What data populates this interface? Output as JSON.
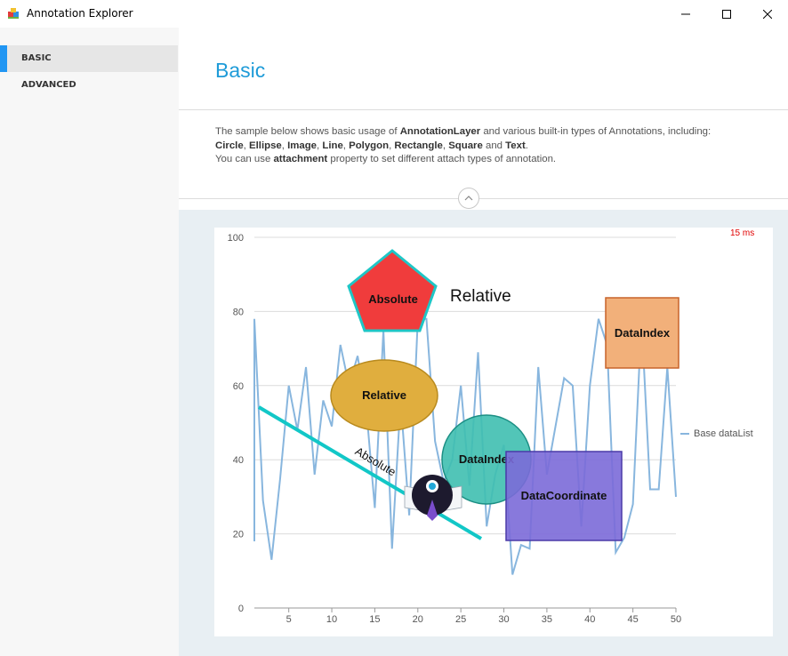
{
  "window": {
    "title": "Annotation Explorer"
  },
  "sidebar": {
    "items": [
      {
        "label": "BASIC",
        "active": true
      },
      {
        "label": "ADVANCED",
        "active": false
      }
    ]
  },
  "page": {
    "title": "Basic",
    "description": {
      "line1_a": "The sample below shows basic usage of ",
      "line1_b": "AnnotationLayer",
      "line1_c": " and various built-in types of Annotations, including:",
      "types": [
        "Circle",
        "Ellipse",
        "Image",
        "Line",
        "Polygon",
        "Rectangle",
        "Square",
        "Text"
      ],
      "line3_a": "You can use ",
      "line3_b": "attachment",
      "line3_c": " property to set different attach types of annotation."
    }
  },
  "timing": "15 ms",
  "colors": {
    "accent": "#1e9bd8",
    "series": "#88b6de",
    "polygon_fill": "#f03c3c",
    "polygon_stroke": "#1fc6c6",
    "ellipse_fill": "#e0ae3e",
    "circle_fill": "#3fbfb0",
    "rect_fill": "#f2b07a",
    "square_fill": "#7b6ad8",
    "line_color": "#12c7c7"
  },
  "chart_data": {
    "type": "line",
    "x": [
      1,
      2,
      3,
      4,
      5,
      6,
      7,
      8,
      9,
      10,
      11,
      12,
      13,
      14,
      15,
      16,
      17,
      18,
      19,
      20,
      21,
      22,
      23,
      24,
      25,
      26,
      27,
      28,
      29,
      30,
      31,
      32,
      33,
      34,
      35,
      36,
      37,
      38,
      39,
      40,
      41,
      42,
      43,
      44,
      45,
      46,
      47,
      48,
      49,
      50
    ],
    "series": [
      {
        "name": "Base dataList",
        "values": [
          18,
          78,
          29,
          13,
          35,
          60,
          48,
          65,
          36,
          56,
          49,
          71,
          60,
          68,
          54,
          27,
          75,
          16,
          56,
          25,
          78,
          78,
          45,
          34,
          40,
          60,
          33,
          69,
          22,
          36,
          44,
          9,
          17,
          16,
          65,
          36,
          49,
          62,
          60,
          22,
          60,
          78,
          71,
          15,
          19,
          28,
          78,
          32,
          32,
          65,
          30
        ]
      }
    ],
    "xlim": [
      1,
      50
    ],
    "ylim": [
      0,
      100
    ],
    "xticks": [
      5,
      10,
      15,
      20,
      25,
      30,
      35,
      40,
      45,
      50
    ],
    "yticks": [
      0,
      20,
      40,
      60,
      80,
      100
    ],
    "legend_position": "right",
    "annotations": [
      {
        "kind": "polygon",
        "text": "Absolute",
        "attachment": "absolute"
      },
      {
        "kind": "text",
        "text": "Relative",
        "attachment": "relative"
      },
      {
        "kind": "rectangle",
        "text": "DataIndex",
        "attachment": "dataIndex"
      },
      {
        "kind": "ellipse",
        "text": "Relative",
        "attachment": "relative"
      },
      {
        "kind": "line",
        "text": "Absolute",
        "attachment": "absolute"
      },
      {
        "kind": "circle",
        "text": "DataIndex",
        "attachment": "dataIndex"
      },
      {
        "kind": "square",
        "text": "DataCoordinate",
        "attachment": "dataCoordinate"
      },
      {
        "kind": "image",
        "text": "",
        "attachment": "absolute"
      }
    ]
  }
}
